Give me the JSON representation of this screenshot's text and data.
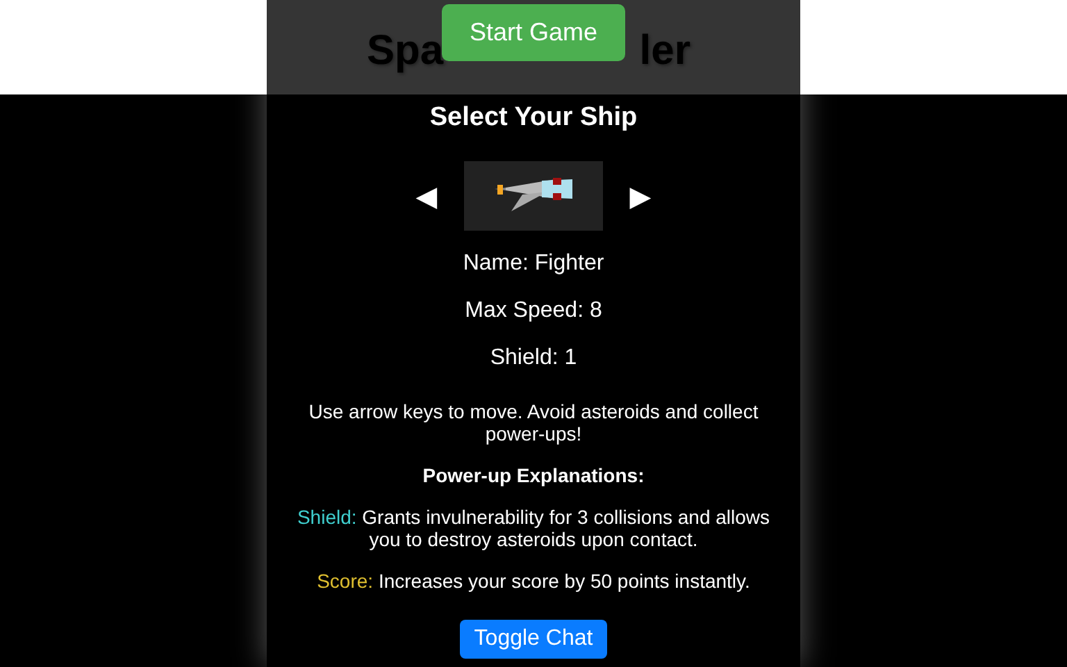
{
  "title_visible_parts": [
    "Spa",
    "ler"
  ],
  "start_button": "Start Game",
  "heading": "Select Your Ship",
  "ship_selector": {
    "prev": "◀",
    "next": "▶"
  },
  "stats": [
    "Name: Fighter",
    "Max Speed: 8",
    "Shield: 1"
  ],
  "instructions": "Use arrow keys to move. Avoid asteroids and collect power-ups!",
  "powerups_heading": "Power-up Explanations:",
  "powerups": [
    {
      "name": "Shield:",
      "color": "#40d0d0",
      "text": "Grants invulnerability for 3 collisions and allows you to destroy asteroids upon contact."
    },
    {
      "name": "Score:",
      "color": "#e0c030",
      "text": "Increases your score by 50 points instantly."
    }
  ],
  "chat_button": "Toggle Chat"
}
